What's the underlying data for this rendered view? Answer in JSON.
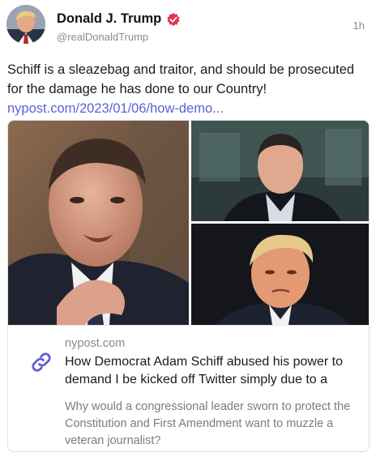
{
  "post": {
    "author": {
      "display_name": "Donald J. Trump",
      "handle": "@realDonaldTrump",
      "verified": true,
      "avatar_icon": "avatar-photo"
    },
    "time_ago": "1h",
    "text": "Schiff is a sleazebag and traitor, and should be prosecuted for the damage he has done to our Country! ",
    "text_link": "nypost.com/2023/01/06/how-demo..."
  },
  "link_card": {
    "images": [
      {
        "name": "photo-adam-schiff"
      },
      {
        "name": "photo-matt-taibbi"
      },
      {
        "name": "photo-donald-trump"
      }
    ],
    "icon": "link-icon",
    "domain": "nypost.com",
    "title": "How Democrat Adam Schiff abused his power to demand I be kicked off Twitter simply due to a",
    "description": "Why would a congressional leader sworn to protect the Constitution and First Amendment want to muzzle a veteran journalist?"
  },
  "colors": {
    "link": "#5f5ed9",
    "verified_badge": "#e8344e",
    "muted_text": "#8a8a93",
    "card_border": "#dedee3"
  }
}
